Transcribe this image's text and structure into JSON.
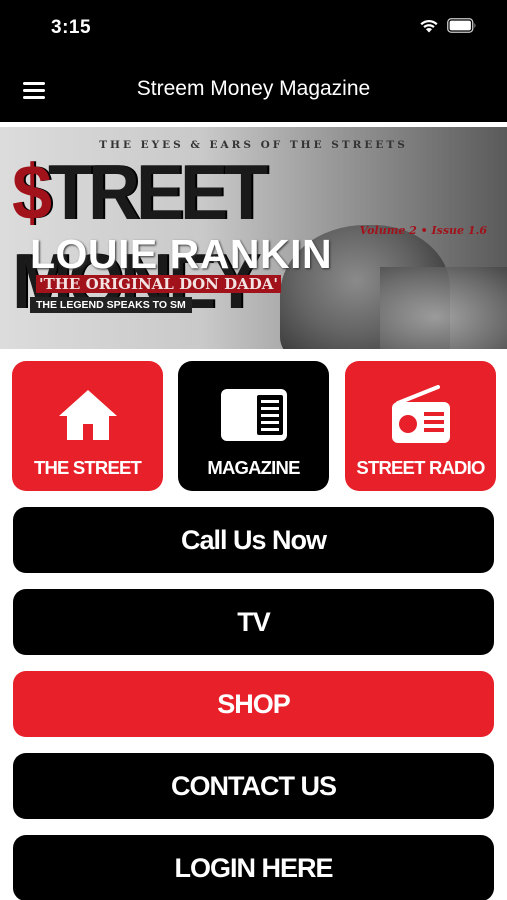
{
  "status_bar": {
    "time": "3:15"
  },
  "nav": {
    "title": "Streem Money Magazine"
  },
  "banner": {
    "tagline": "THE EYES & EARS OF THE STREETS",
    "title_dollar": "$",
    "title_rest": "TREET MONEY",
    "issue": "Volume 2 • Issue 1.6",
    "name": "LOUIE RANKIN",
    "subtitle": "'THE ORIGINAL DON DADA'",
    "legend": "THE LEGEND SPEAKS TO SM"
  },
  "tiles": [
    {
      "label": "THE STREET",
      "icon": "home-icon",
      "color": "#e8202a"
    },
    {
      "label": "MAGAZINE",
      "icon": "newspaper-icon",
      "color": "#000000"
    },
    {
      "label": "STREET RADIO",
      "icon": "radio-icon",
      "color": "#e8202a"
    }
  ],
  "buttons": [
    {
      "label": "Call Us Now",
      "color": "#000000"
    },
    {
      "label": "TV",
      "color": "#000000"
    },
    {
      "label": "SHOP",
      "color": "#e8202a"
    },
    {
      "label": "CONTACT US",
      "color": "#000000"
    },
    {
      "label": "LOGIN HERE",
      "color": "#000000"
    }
  ],
  "colors": {
    "accent_red": "#e8202a",
    "dark": "#000000",
    "background": "#ffffff"
  }
}
